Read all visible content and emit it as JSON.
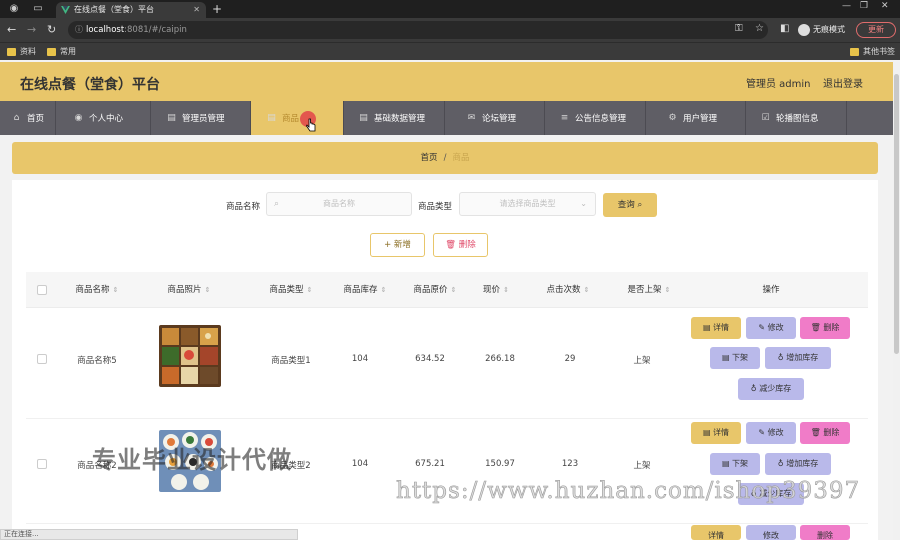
{
  "browser": {
    "tab_title": "在线点餐（堂食）平台",
    "url_host": "localhost",
    "url_path": ":8081/#/caipin",
    "profile_label": "无痕模式",
    "update_label": "更新",
    "bookmarks": [
      "资料",
      "常用"
    ],
    "other_bookmarks": "其他书签"
  },
  "header": {
    "title": "在线点餐（堂食）平台",
    "admin": "管理员 admin",
    "logout": "退出登录"
  },
  "nav": {
    "items": [
      {
        "label": "首页",
        "icon": "home-icon"
      },
      {
        "label": "个人中心",
        "icon": "user-icon"
      },
      {
        "label": "管理员管理",
        "icon": "doc-icon"
      },
      {
        "label": "商品",
        "icon": "doc-icon"
      },
      {
        "label": "基础数据管理",
        "icon": "doc-icon"
      },
      {
        "label": "论坛管理",
        "icon": "mail-icon"
      },
      {
        "label": "公告信息管理",
        "icon": "list-icon"
      },
      {
        "label": "用户管理",
        "icon": "gear-icon"
      },
      {
        "label": "轮播图信息",
        "icon": "check-icon"
      }
    ],
    "active_index": 3
  },
  "breadcrumb": {
    "home": "首页",
    "sep": "/",
    "current": "商品"
  },
  "search": {
    "name_label": "商品名称",
    "name_placeholder": "商品名称",
    "type_label": "商品类型",
    "type_placeholder": "请选择商品类型",
    "query_button": "查询"
  },
  "actions": {
    "add": "新增",
    "delete": "删除"
  },
  "table": {
    "columns": [
      "商品名称",
      "商品照片",
      "商品类型",
      "商品库存",
      "商品原价",
      "现价",
      "点击次数",
      "是否上架",
      "操作"
    ],
    "rows": [
      {
        "name": "商品名称5",
        "type": "商品类型1",
        "stock": "104",
        "orig_price": "634.52",
        "price": "266.18",
        "clicks": "29",
        "listed": "上架"
      },
      {
        "name": "商品名称2",
        "type": "商品类型2",
        "stock": "104",
        "orig_price": "675.21",
        "price": "150.97",
        "clicks": "123",
        "listed": "上架"
      }
    ],
    "row_buttons": {
      "detail": "详情",
      "edit": "修改",
      "remove": "删除",
      "off": "下架",
      "inc": "增加库存",
      "dec": "减少库存"
    }
  },
  "watermark": {
    "text1": "专业毕业设计代做",
    "text2": "https://www.huzhan.com/ishop39397"
  },
  "statusbar": {
    "text": "正在连接..."
  }
}
